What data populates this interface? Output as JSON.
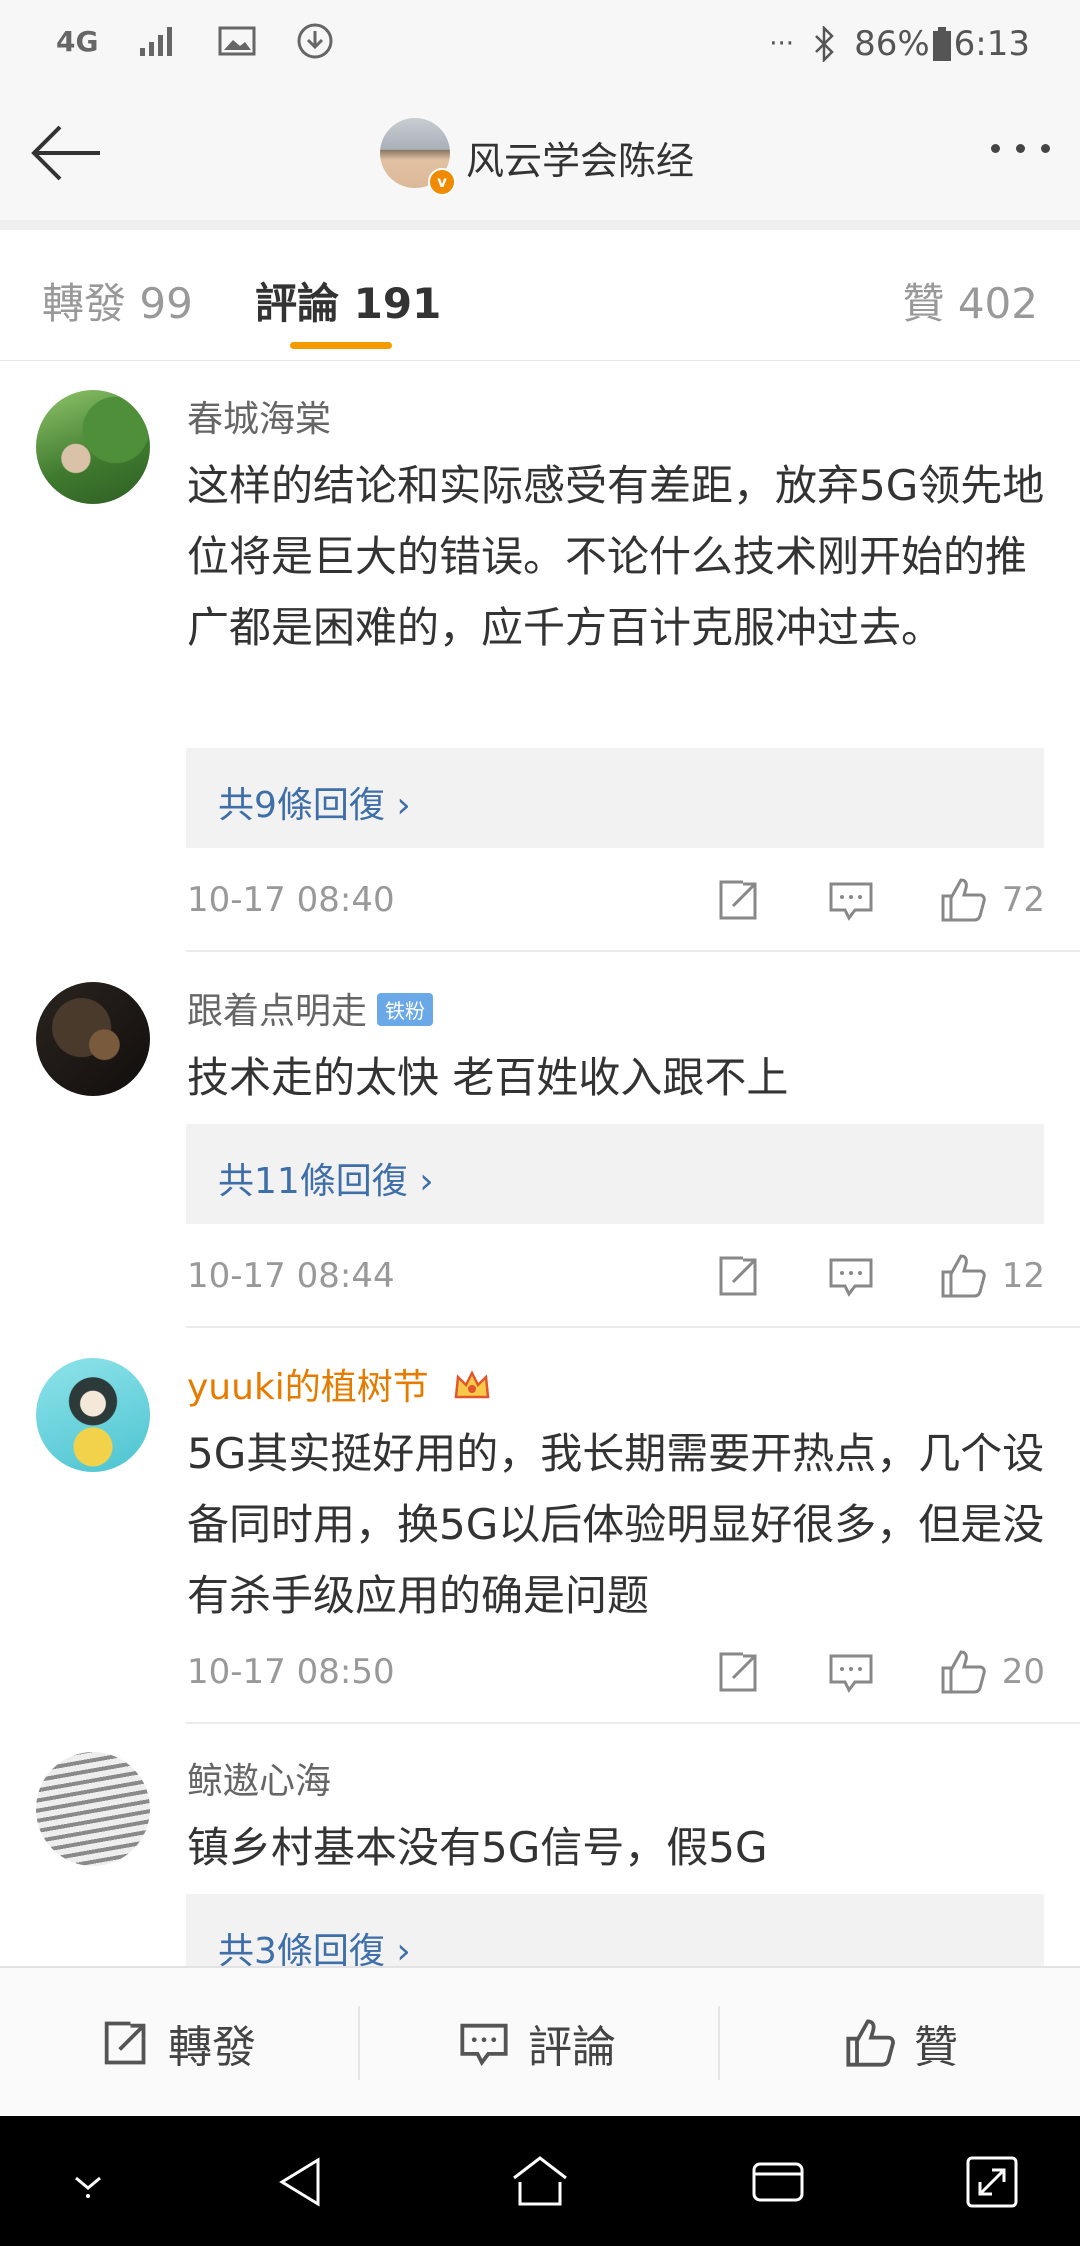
{
  "status_bar": {
    "network": "4G",
    "battery": "86%",
    "time": "6:13",
    "more": "···"
  },
  "header": {
    "title": "风云学会陈经"
  },
  "tabs": [
    {
      "label": "轉發 99"
    },
    {
      "label": "評論 191"
    },
    {
      "label": "贊 402"
    }
  ],
  "comments": [
    {
      "name": "春城海棠",
      "text": "这样的结论和实际感受有差距，放弃5G领先地位将是巨大的错误。不论什么技术刚开始的推广都是困难的，应千方百计克服冲过去。",
      "replies": "共9條回復",
      "time": "10-17 08:40",
      "likes": "72"
    },
    {
      "name": "跟着点明走",
      "badge": "铁粉",
      "text": "技术走的太快 老百姓收入跟不上",
      "replies": "共11條回復",
      "time": "10-17 08:44",
      "likes": "12"
    },
    {
      "name": "yuuki的植树节",
      "text": "5G其实挺好用的，我长期需要开热点，几个设备同时用，换5G以后体验明显好很多，但是没有杀手级应用的确是问题",
      "time": "10-17 08:50",
      "likes": "20"
    },
    {
      "name": "鲸遨心海",
      "text": "镇乡村基本没有5G信号，假5G",
      "replies": "共3條回復"
    }
  ],
  "bottom_bar": {
    "repost": "轉發",
    "comment": "評論",
    "like": "贊"
  },
  "colors": {
    "accent": "#f49b00",
    "link": "#3f6fa8",
    "vip_name": "#e57c00"
  }
}
